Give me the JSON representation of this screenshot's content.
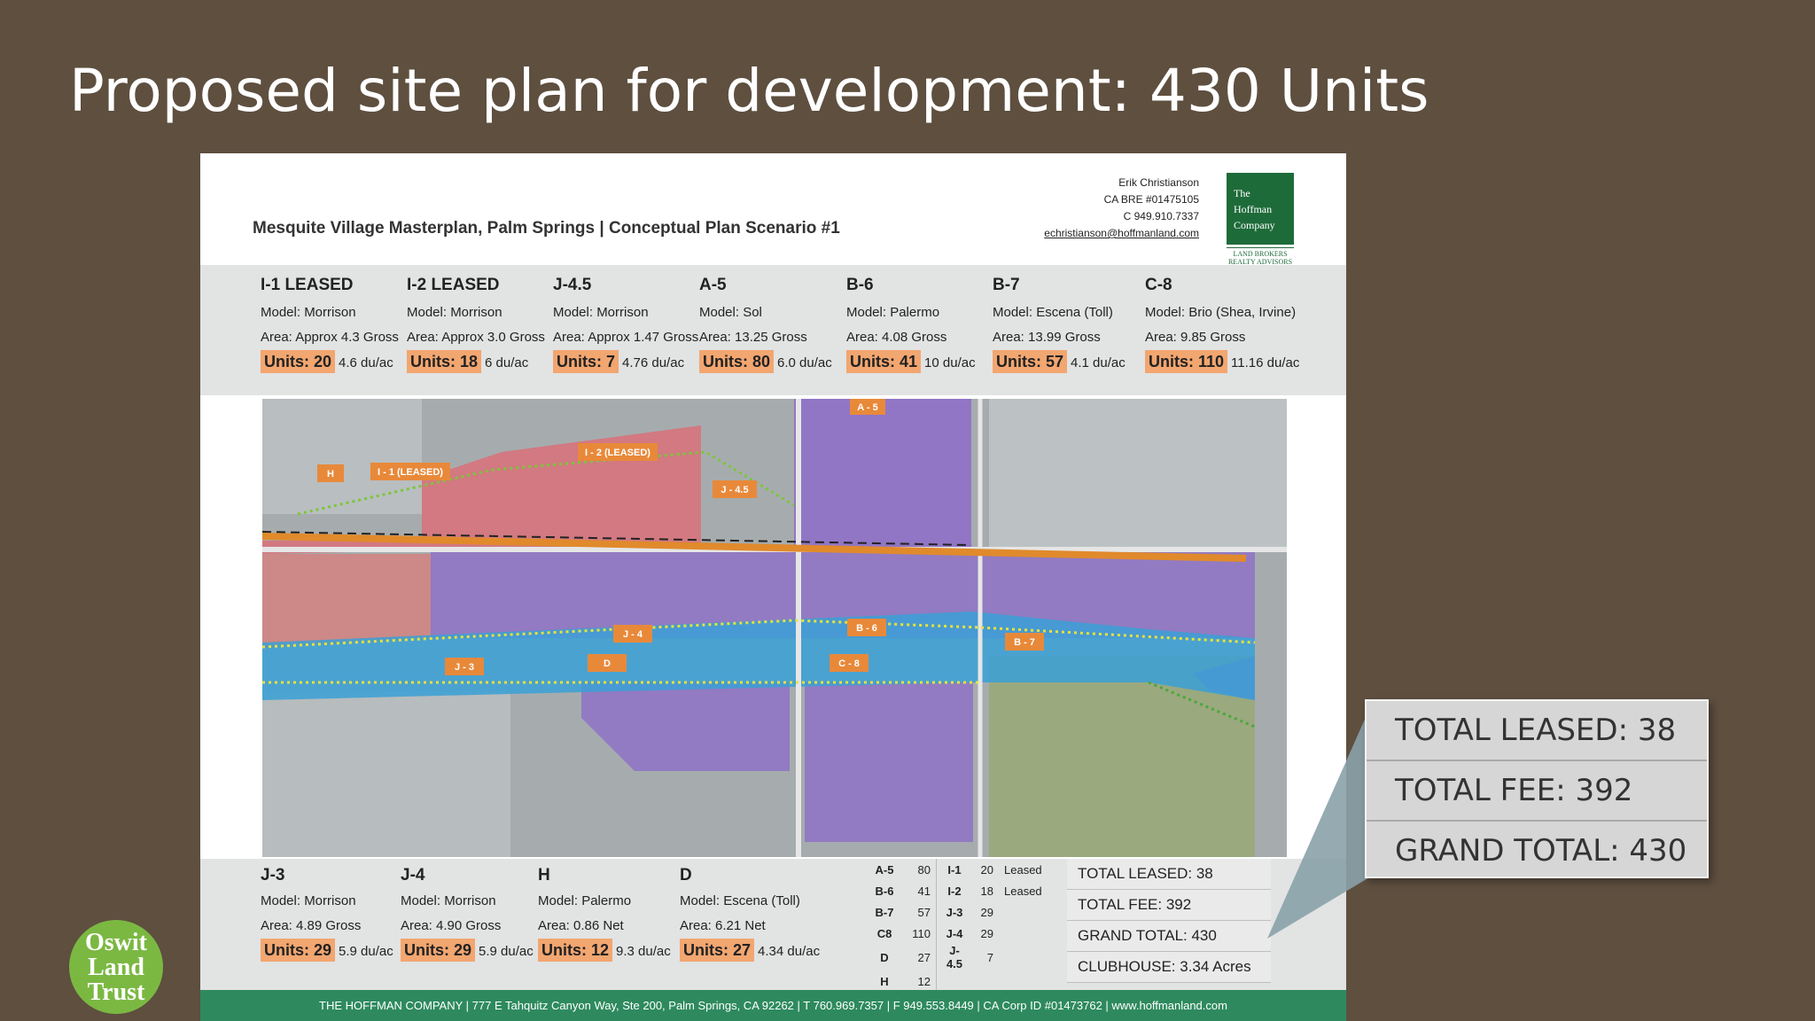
{
  "slide": {
    "title": "Proposed site plan for development: 430 Units"
  },
  "sheet": {
    "plan_title": "Mesquite Village Masterplan, Palm Springs  |  Conceptual Plan Scenario #1",
    "contact": {
      "name": "Erik Christianson",
      "license": "CA BRE #01475105",
      "phone": "C 949.910.7337",
      "email": "echristianson@hoffmanland.com"
    },
    "logo": {
      "line1": "The",
      "line2": "Hoffman",
      "line3": "Company",
      "sub1": "LAND BROKERS",
      "sub2": "REALTY ADVISORS"
    },
    "top_parcels": [
      {
        "name": "I-1 LEASED",
        "model": "Model: Morrison",
        "area": "Area: Approx 4.3 Gross",
        "units": "Units: 20",
        "density": "4.6 du/ac"
      },
      {
        "name": "I-2 LEASED",
        "model": "Model: Morrison",
        "area": "Area: Approx 3.0 Gross",
        "units": "Units: 18",
        "density": "6 du/ac"
      },
      {
        "name": "J-4.5",
        "model": "Model: Morrison",
        "area": "Area: Approx 1.47 Gross",
        "units": "Units: 7",
        "density": "4.76 du/ac"
      },
      {
        "name": "A-5",
        "model": "Model: Sol",
        "area": "Area: 13.25 Gross",
        "units": "Units: 80",
        "density": "6.0 du/ac"
      },
      {
        "name": "B-6",
        "model": "Model: Palermo",
        "area": "Area: 4.08 Gross",
        "units": "Units: 41",
        "density": "10 du/ac"
      },
      {
        "name": "B-7",
        "model": "Model: Escena (Toll)",
        "area": "Area: 13.99 Gross",
        "units": "Units: 57",
        "density": "4.1 du/ac"
      },
      {
        "name": "C-8",
        "model": "Model: Brio (Shea, Irvine)",
        "area": "Area: 9.85 Gross",
        "units": "Units: 110",
        "density": "11.16 du/ac"
      }
    ],
    "bottom_parcels": [
      {
        "name": "J-3",
        "model": "Model: Morrison",
        "area": "Area: 4.89 Gross",
        "units": "Units: 29",
        "density": "5.9 du/ac"
      },
      {
        "name": "J-4",
        "model": "Model: Morrison",
        "area": "Area: 4.90 Gross",
        "units": "Units: 29",
        "density": "5.9 du/ac"
      },
      {
        "name": "H",
        "model": "Model: Palermo",
        "area": "Area: 0.86 Net",
        "units": "Units: 12",
        "density": "9.3 du/ac"
      },
      {
        "name": "D",
        "model": "Model: Escena (Toll)",
        "area": "Area: 6.21 Net",
        "units": "Units: 27",
        "density": "4.34 du/ac"
      }
    ],
    "unit_table": [
      [
        "A-5",
        "80",
        "I-1",
        "20",
        "Leased"
      ],
      [
        "B-6",
        "41",
        "I-2",
        "18",
        "Leased"
      ],
      [
        "B-7",
        "57",
        "J-3",
        "29",
        ""
      ],
      [
        "C8",
        "110",
        "J-4",
        "29",
        ""
      ],
      [
        "D",
        "27",
        "J-4.5",
        "7",
        ""
      ],
      [
        "H",
        "12",
        "",
        "",
        ""
      ]
    ],
    "totals": {
      "leased": "TOTAL LEASED: 38",
      "fee": "TOTAL FEE: 392",
      "grand": "GRAND TOTAL: 430",
      "clubhouse": "CLUBHOUSE: 3.34 Acres"
    },
    "footer": "THE HOFFMAN COMPANY | 777 E Tahquitz Canyon Way, Ste 200, Palm Springs, CA 92262 | T 760.969.7357 | F 949.553.8449 | CA Corp ID #01473762 | www.hoffmanland.com",
    "map_labels": [
      "H",
      "I - 1 (LEASED)",
      "I - 2 (LEASED)",
      "J - 4.5",
      "A - 5",
      "J - 4",
      "J - 3",
      "D",
      "B - 6",
      "C - 8",
      "B - 7"
    ]
  },
  "callout": {
    "leased": "TOTAL LEASED: 38",
    "fee": "TOTAL FEE: 392",
    "grand": "GRAND TOTAL: 430"
  },
  "badge": {
    "line1": "Oswit",
    "line2": "Land",
    "line3": "Trust"
  },
  "colors": {
    "background": "#5e4f3f",
    "accent_orange": "#f2a670",
    "footer_green": "#2e8a5e",
    "logo_green": "#1e6b3a",
    "badge_green": "#7bb842"
  }
}
